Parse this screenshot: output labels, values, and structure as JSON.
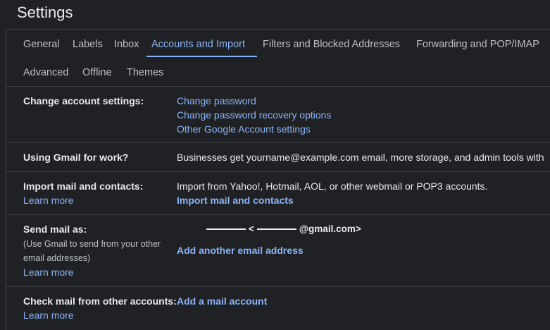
{
  "page": {
    "title": "Settings"
  },
  "tabs": [
    {
      "label": "General"
    },
    {
      "label": "Labels"
    },
    {
      "label": "Inbox"
    },
    {
      "label": "Accounts and Import"
    },
    {
      "label": "Filters and Blocked Addresses"
    },
    {
      "label": "Forwarding and POP/IMAP"
    },
    {
      "label": "Advanced"
    },
    {
      "label": "Offline"
    },
    {
      "label": "Themes"
    }
  ],
  "active_tab": "Accounts and Import",
  "sections": {
    "change_account": {
      "label": "Change account settings:",
      "links": [
        "Change password",
        "Change password recovery options",
        "Other Google Account settings"
      ]
    },
    "work": {
      "label": "Using Gmail for work?",
      "text": "Businesses get yourname@example.com email, more storage, and admin tools with"
    },
    "import": {
      "label": "Import mail and contacts:",
      "learn_more": "Learn more",
      "text": "Import from Yahoo!, Hotmail, AOL, or other webmail or POP3 accounts.",
      "action": "Import mail and contacts"
    },
    "send_as": {
      "label": "Send mail as:",
      "sublabel": "(Use Gmail to send from your other email addresses)",
      "learn_more": "Learn more",
      "email_sep": "<",
      "email_domain": "@gmail.com>",
      "action": "Add another email address"
    },
    "check_mail": {
      "label": "Check mail from other accounts:",
      "learn_more": "Learn more",
      "action": "Add a mail account"
    }
  },
  "colors": {
    "background": "#202124",
    "link": "#8ab4f8",
    "text": "#e8eaed",
    "muted": "#bdc1c6",
    "divider": "#3c4043"
  }
}
